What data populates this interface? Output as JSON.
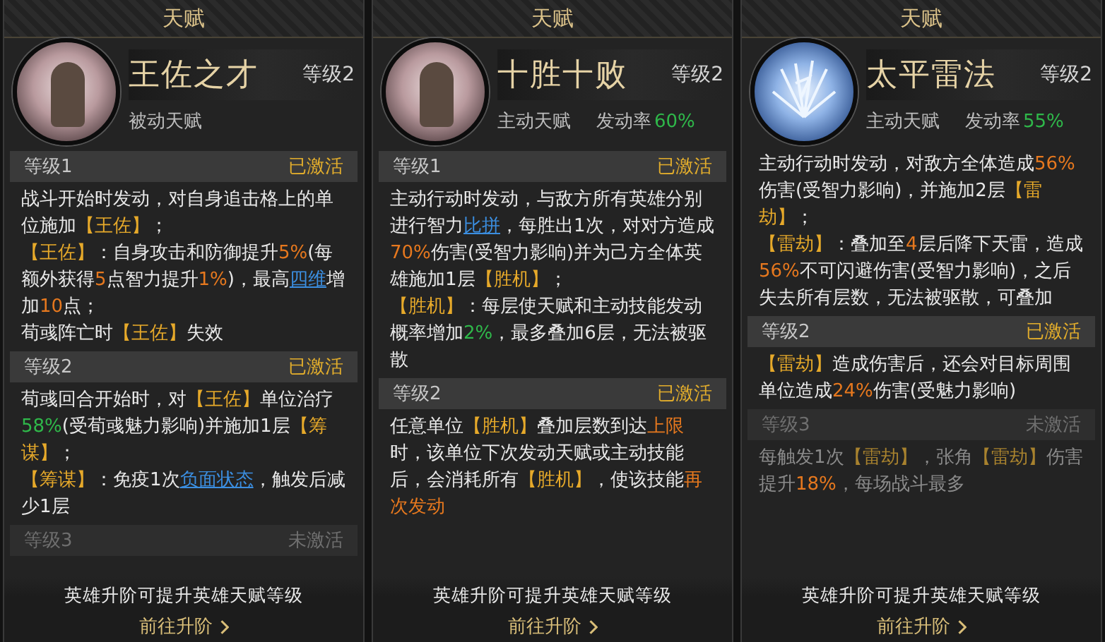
{
  "talents": [
    {
      "title": "天赋",
      "name": "王佐之才",
      "level": "等级2",
      "type": "被动天赋",
      "kind": "figure",
      "sections": [
        {
          "label": "等级1",
          "status": "已激活",
          "active": true,
          "paragraphs": [
            [
              {
                "text": "战斗开始时发动，对自身追击格上的单位施加",
                "kind": "plain"
              },
              {
                "text": "【王佐】",
                "kind": "gold"
              },
              {
                "text": "；",
                "kind": "plain"
              }
            ],
            [
              {
                "text": "【王佐】",
                "kind": "gold"
              },
              {
                "text": "：自身攻击和防御提升",
                "kind": "plain"
              },
              {
                "text": "5%",
                "kind": "orange"
              },
              {
                "text": "(每额外获得",
                "kind": "plain"
              },
              {
                "text": "5",
                "kind": "orange"
              },
              {
                "text": "点智力提升",
                "kind": "plain"
              },
              {
                "text": "1%",
                "kind": "orange"
              },
              {
                "text": ")，最高",
                "kind": "plain"
              },
              {
                "text": "四维",
                "kind": "link"
              },
              {
                "text": "增加",
                "kind": "plain"
              },
              {
                "text": "10",
                "kind": "orange"
              },
              {
                "text": "点；",
                "kind": "plain"
              }
            ],
            [
              {
                "text": "荀彧阵亡时",
                "kind": "plain"
              },
              {
                "text": "【王佐】",
                "kind": "gold"
              },
              {
                "text": "失效",
                "kind": "plain"
              }
            ]
          ]
        },
        {
          "label": "等级2",
          "status": "已激活",
          "active": true,
          "paragraphs": [
            [
              {
                "text": "荀彧回合开始时，对",
                "kind": "plain"
              },
              {
                "text": "【王佐】",
                "kind": "gold"
              },
              {
                "text": "单位治疗",
                "kind": "plain"
              },
              {
                "text": "58%",
                "kind": "green"
              },
              {
                "text": "(受荀彧魅力影响)并施加1层",
                "kind": "plain"
              },
              {
                "text": "【筹谋】",
                "kind": "gold"
              },
              {
                "text": "；",
                "kind": "plain"
              }
            ],
            [
              {
                "text": "【筹谋】",
                "kind": "gold"
              },
              {
                "text": "：免疫1次",
                "kind": "plain"
              },
              {
                "text": "负面状态",
                "kind": "link"
              },
              {
                "text": "，触发后减少1层",
                "kind": "plain"
              }
            ]
          ]
        },
        {
          "label": "等级3",
          "status": "未激活",
          "active": false
        }
      ],
      "note": "英雄升阶可提升英雄天赋等级",
      "link": "前往升阶"
    },
    {
      "title": "天赋",
      "name": "十胜十败",
      "level": "等级2",
      "type": "主动天赋",
      "rate_label": "发动率",
      "rate": "60%",
      "kind": "figure",
      "sections": [
        {
          "label": "等级1",
          "status": "已激活",
          "active": true,
          "paragraphs": [
            [
              {
                "text": "主动行动时发动，与敌方所有英雄分别进行智力",
                "kind": "plain"
              },
              {
                "text": "比拼",
                "kind": "link"
              },
              {
                "text": "，每胜出1次，对对方造成",
                "kind": "plain"
              },
              {
                "text": "70%",
                "kind": "orange"
              },
              {
                "text": "伤害(受智力影响)并为己方全体英雄施加1层",
                "kind": "plain"
              },
              {
                "text": "【胜机】",
                "kind": "gold"
              },
              {
                "text": "；",
                "kind": "plain"
              }
            ],
            [
              {
                "text": "【胜机】",
                "kind": "gold"
              },
              {
                "text": "：每层使天赋和主动技能发动概率增加",
                "kind": "plain"
              },
              {
                "text": "2%",
                "kind": "green"
              },
              {
                "text": "，最多叠加6层，无法被驱散",
                "kind": "plain"
              }
            ]
          ]
        },
        {
          "label": "等级2",
          "status": "已激活",
          "active": true,
          "paragraphs": [
            [
              {
                "text": "任意单位",
                "kind": "plain"
              },
              {
                "text": "【胜机】",
                "kind": "gold"
              },
              {
                "text": "叠加层数到达",
                "kind": "plain"
              },
              {
                "text": "上限",
                "kind": "orange"
              },
              {
                "text": "时，该单位下次发动天赋或主动技能后，会消耗所有",
                "kind": "plain"
              },
              {
                "text": "【胜机】",
                "kind": "gold"
              },
              {
                "text": "，使该技能",
                "kind": "plain"
              },
              {
                "text": "再次发动",
                "kind": "orange"
              }
            ]
          ]
        }
      ],
      "note": "英雄升阶可提升英雄天赋等级",
      "link": "前往升阶"
    },
    {
      "title": "天赋",
      "name": "太平雷法",
      "level": "等级2",
      "type": "主动天赋",
      "rate_label": "发动率",
      "rate": "55%",
      "kind": "lightning",
      "sections": [
        {
          "paragraphs": [
            [
              {
                "text": "主动行动时发动，对敌方全体造成",
                "kind": "plain"
              },
              {
                "text": "56%",
                "kind": "orange"
              },
              {
                "text": "伤害(受智力影响)，并施加2层",
                "kind": "plain"
              },
              {
                "text": "【雷劫】",
                "kind": "gold"
              },
              {
                "text": "；",
                "kind": "plain"
              }
            ],
            [
              {
                "text": "【雷劫】",
                "kind": "gold"
              },
              {
                "text": "：叠加至",
                "kind": "plain"
              },
              {
                "text": "4",
                "kind": "orange"
              },
              {
                "text": "层后降下天雷，造成",
                "kind": "plain"
              },
              {
                "text": "56%",
                "kind": "orange"
              },
              {
                "text": "不可闪避伤害(受智力影响)，之后失去所有层数，无法被驱散，可叠加",
                "kind": "plain"
              }
            ]
          ]
        },
        {
          "label": "等级2",
          "status": "已激活",
          "active": true,
          "paragraphs": [
            [
              {
                "text": "【雷劫】",
                "kind": "gold"
              },
              {
                "text": "造成伤害后，还会对目标周围单位造成",
                "kind": "plain"
              },
              {
                "text": "24%",
                "kind": "orange"
              },
              {
                "text": "伤害(受魅力影响)",
                "kind": "plain"
              }
            ]
          ]
        },
        {
          "label": "等级3",
          "status": "未激活",
          "active": false,
          "paragraphs": [
            [
              {
                "text": "每触发1次",
                "kind": "plain"
              },
              {
                "text": "【雷劫】",
                "kind": "gold"
              },
              {
                "text": "，张角",
                "kind": "plain"
              },
              {
                "text": "【雷劫】",
                "kind": "gold"
              },
              {
                "text": "伤害提升",
                "kind": "plain"
              },
              {
                "text": "18%",
                "kind": "orange"
              },
              {
                "text": "，每场战斗最多",
                "kind": "plain"
              }
            ]
          ]
        }
      ],
      "note": "英雄升阶可提升英雄天赋等级",
      "link": "前往升阶"
    }
  ]
}
